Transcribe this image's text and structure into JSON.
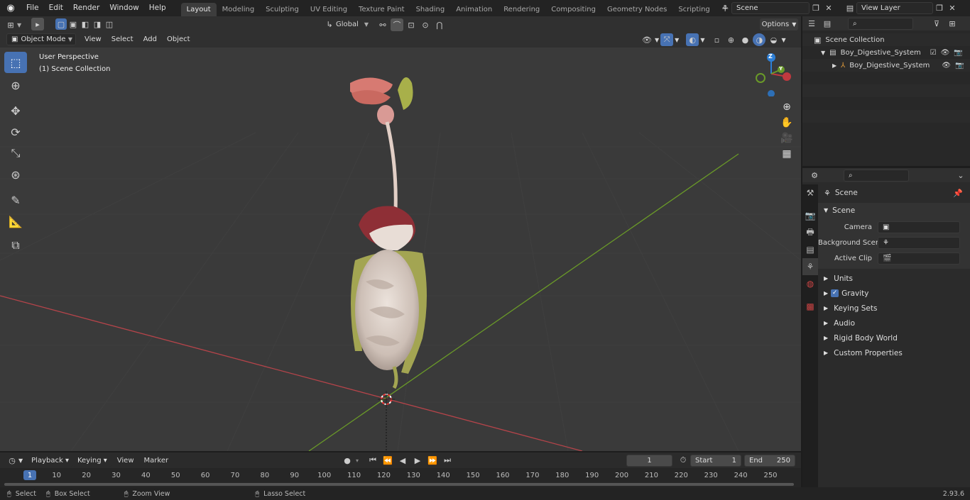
{
  "menu": [
    "File",
    "Edit",
    "Render",
    "Window",
    "Help"
  ],
  "workspaces": [
    "Layout",
    "Modeling",
    "Sculpting",
    "UV Editing",
    "Texture Paint",
    "Shading",
    "Animation",
    "Rendering",
    "Compositing",
    "Geometry Nodes",
    "Scripting"
  ],
  "active_workspace": "Layout",
  "scene_name": "Scene",
  "view_layer": "View Layer",
  "header3d": {
    "transform_orientation": "Global",
    "options": "Options",
    "mode": "Object Mode",
    "menus": [
      "View",
      "Select",
      "Add",
      "Object"
    ]
  },
  "viewport": {
    "perspective": "User Perspective",
    "collection": "(1) Scene Collection"
  },
  "gizmo": {
    "z": "Z",
    "y": "Y"
  },
  "outliner": {
    "root": "Scene Collection",
    "items": [
      {
        "label": "Boy_Digestive_System",
        "type": "collection"
      },
      {
        "label": "Boy_Digestive_System",
        "type": "object"
      }
    ]
  },
  "properties": {
    "header": "Scene",
    "section": "Scene",
    "fields": [
      {
        "label": "Camera"
      },
      {
        "label": "Background Scene"
      },
      {
        "label": "Active Clip"
      }
    ],
    "panels": [
      "Units",
      "Gravity",
      "Keying Sets",
      "Audio",
      "Rigid Body World",
      "Custom Properties"
    ]
  },
  "timeline": {
    "menus": [
      "Playback",
      "Keying",
      "View",
      "Marker"
    ],
    "current_frame": "1",
    "start_label": "Start",
    "start": "1",
    "end_label": "End",
    "end": "250",
    "ticks": [
      "1",
      "10",
      "20",
      "30",
      "40",
      "50",
      "60",
      "70",
      "80",
      "90",
      "100",
      "110",
      "120",
      "130",
      "140",
      "150",
      "160",
      "170",
      "180",
      "190",
      "200",
      "210",
      "220",
      "230",
      "240",
      "250"
    ]
  },
  "status": {
    "select": "Select",
    "box_select": "Box Select",
    "zoom_view": "Zoom View",
    "lasso_select": "Lasso Select",
    "version": "2.93.6"
  },
  "colors": {
    "accent": "#4772b3",
    "x_axis": "#c0393f",
    "y_axis": "#6a9a28",
    "z_axis": "#2d7fd6"
  }
}
